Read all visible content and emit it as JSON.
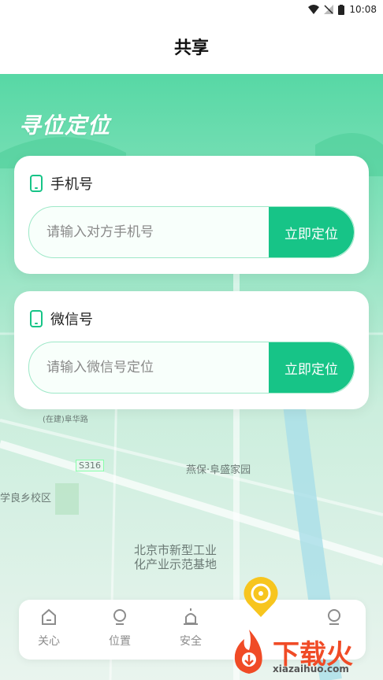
{
  "status": {
    "time": "10:08",
    "wifi_icon": "wifi-icon",
    "signal_icon": "signal-off-icon",
    "battery_icon": "battery-icon"
  },
  "header": {
    "title": "共享"
  },
  "banner": {
    "title": "寻位定位"
  },
  "cards": [
    {
      "icon": "phone-icon",
      "label": "手机号",
      "placeholder": "请输入对方手机号",
      "button": "立即定位"
    },
    {
      "icon": "phone-icon",
      "label": "微信号",
      "placeholder": "请输入微信号定位",
      "button": "立即定位"
    }
  ],
  "map": {
    "labels": [
      "(在建)阜华路",
      "S316",
      "燕保·阜盛家园",
      "学良乡校区",
      "北京市新型工业",
      "化产业示范基地"
    ]
  },
  "tabbar": {
    "items": [
      {
        "label": "关心",
        "icon": "home-icon"
      },
      {
        "label": "位置",
        "icon": "location-icon"
      },
      {
        "label": "安全",
        "icon": "alarm-icon"
      },
      {
        "label": "",
        "icon": "user-icon"
      }
    ],
    "fab_icon": "share-location-icon"
  },
  "watermark": {
    "text": "下载火",
    "url": "xiazaihuo.com"
  },
  "colors": {
    "accent": "#17c487",
    "map_top": "#57d8a5",
    "map_bottom": "#e9f4ee"
  }
}
